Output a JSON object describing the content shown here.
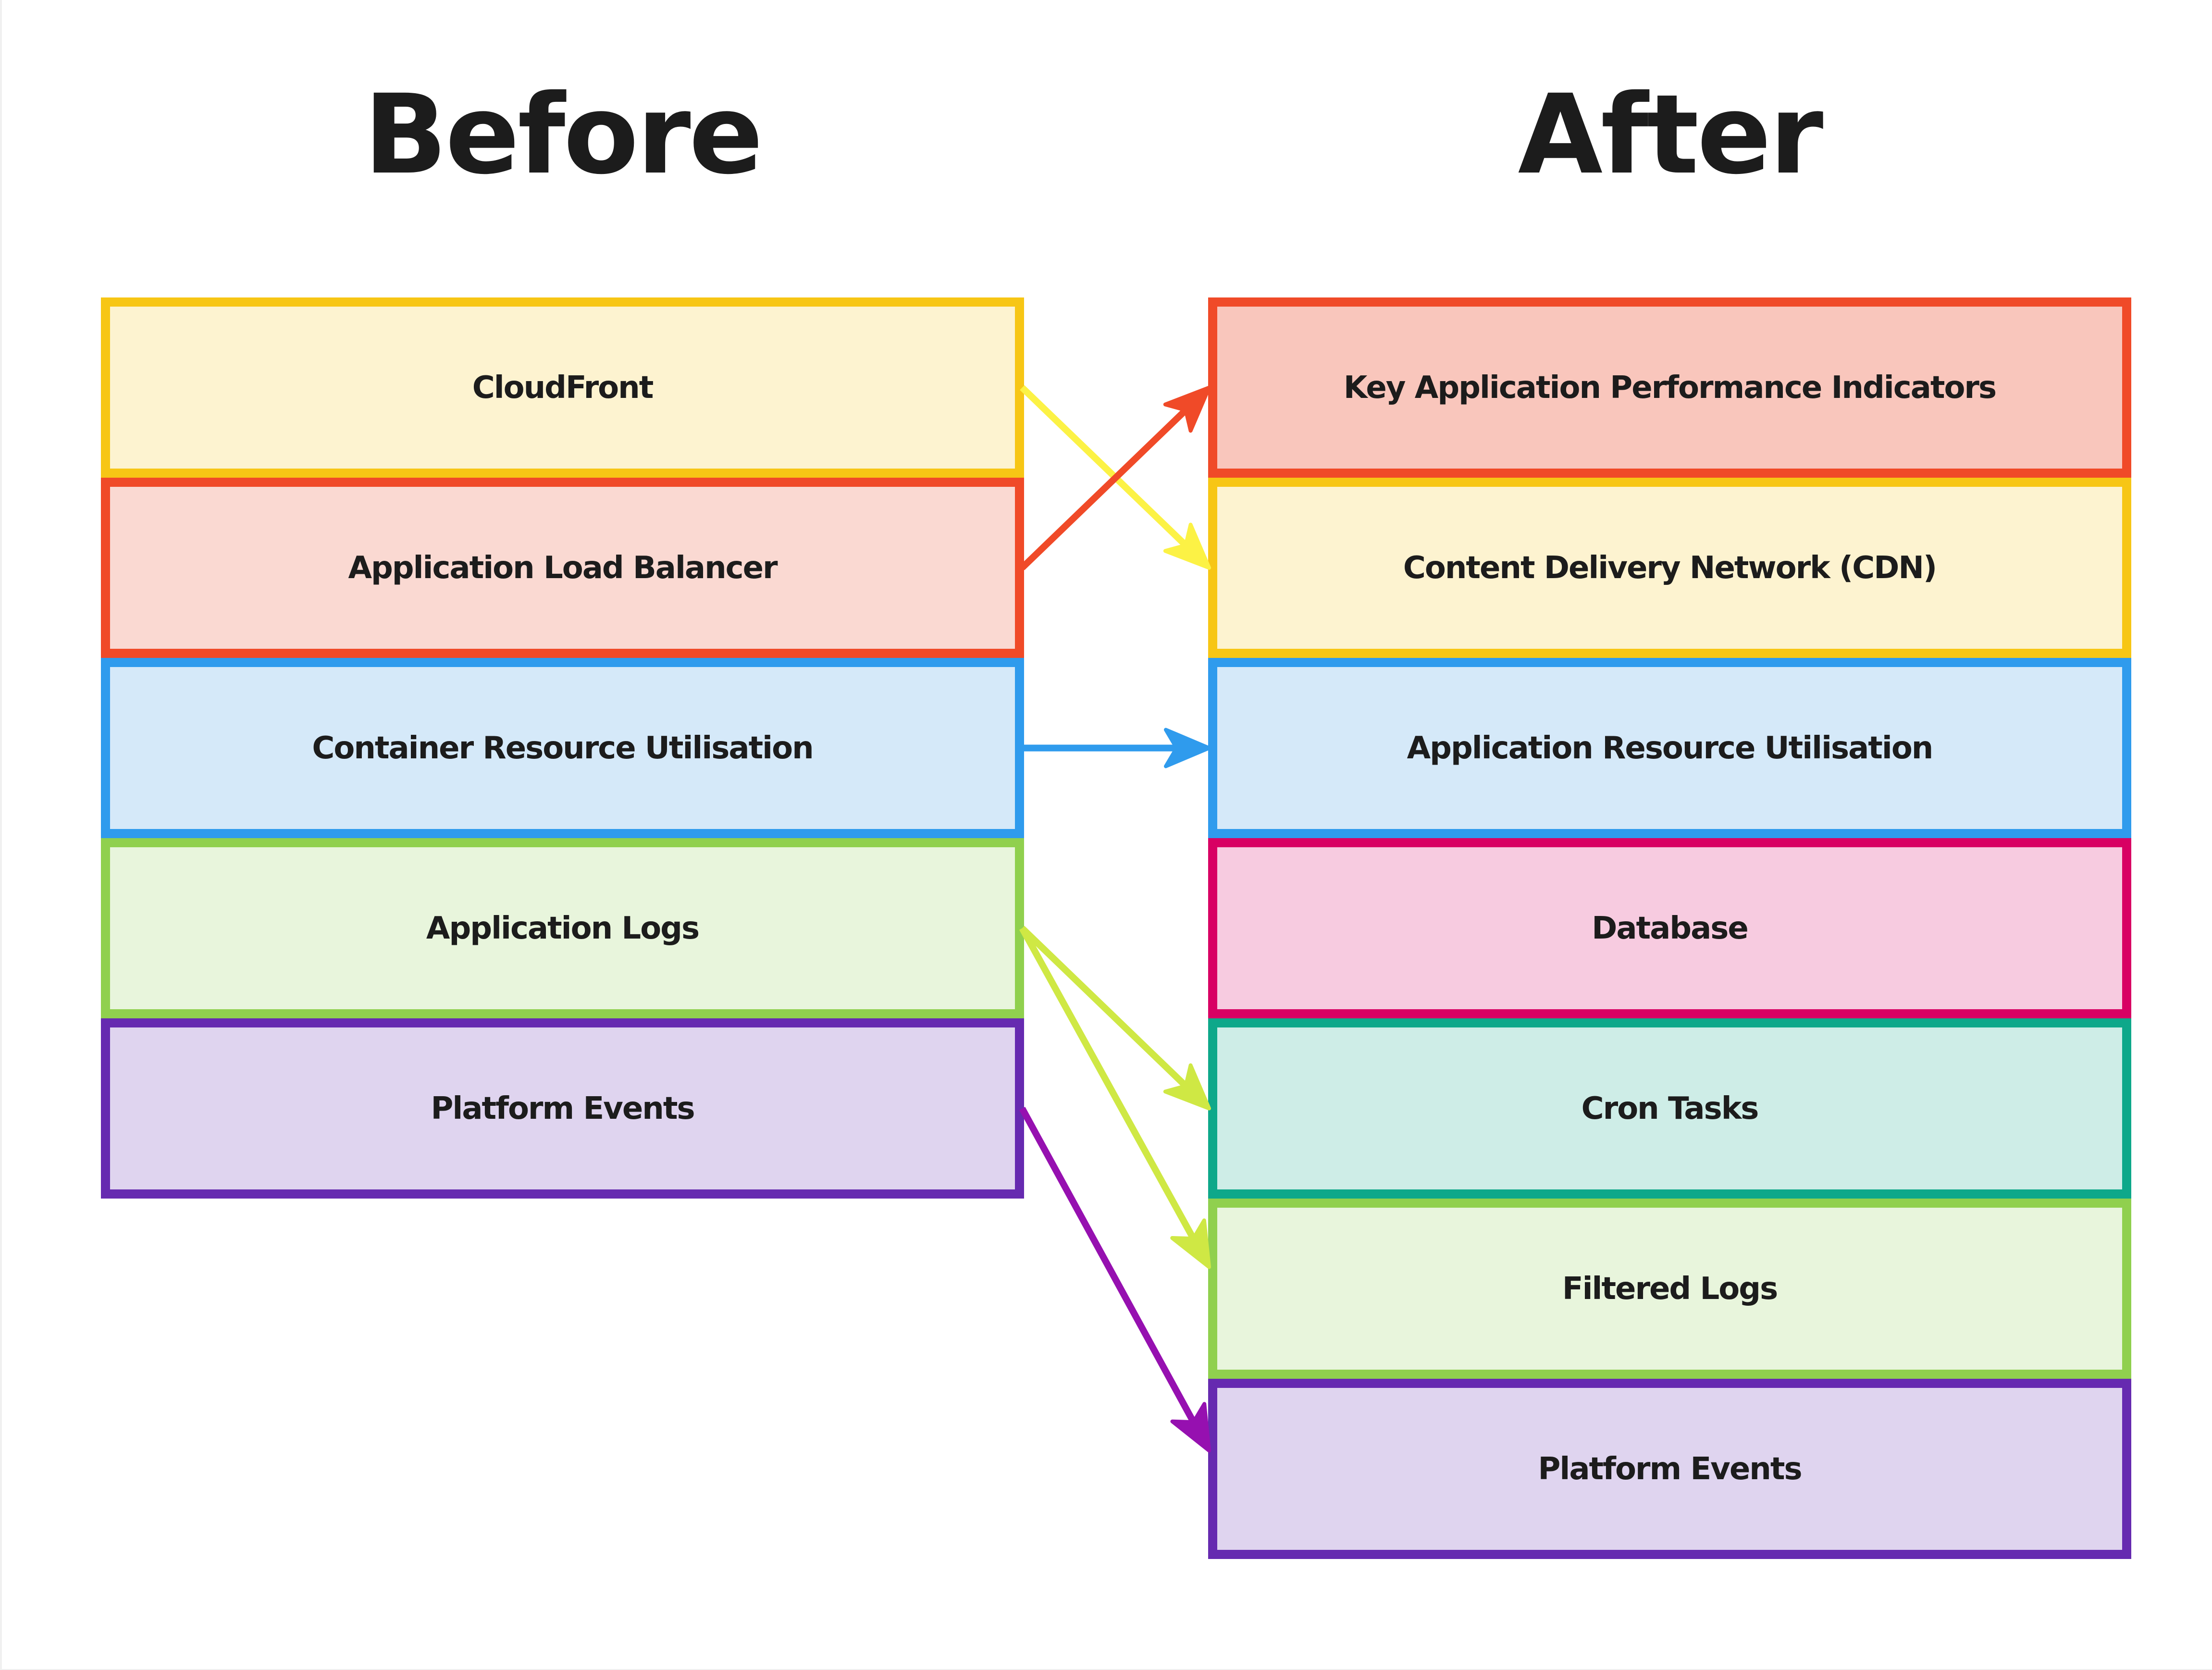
{
  "titles": {
    "before": "Before",
    "after": "After"
  },
  "before": {
    "items": [
      {
        "label": "CloudFront",
        "border": "#f7c615",
        "fill": "#fdf3d0"
      },
      {
        "label": "Application Load Balancer",
        "border": "#f04a28",
        "fill": "#fad9d2"
      },
      {
        "label": "Container Resource Utilisation",
        "border": "#2f9bed",
        "fill": "#d5e9f9"
      },
      {
        "label": "Application Logs",
        "border": "#90d04e",
        "fill": "#e8f5dc"
      },
      {
        "label": "Platform Events",
        "border": "#662ab0",
        "fill": "#dfd4ef"
      }
    ]
  },
  "after": {
    "items": [
      {
        "label": "Key Application Performance Indicators",
        "border": "#f04a28",
        "fill": "#f9c6bc"
      },
      {
        "label": "Content Delivery Network (CDN)",
        "border": "#f7c615",
        "fill": "#fdf3d0"
      },
      {
        "label": "Application Resource Utilisation",
        "border": "#2f9bed",
        "fill": "#d5e9f9"
      },
      {
        "label": "Database",
        "border": "#d80063",
        "fill": "#f7cbe0"
      },
      {
        "label": "Cron Tasks",
        "border": "#0ea88a",
        "fill": "#ceede7"
      },
      {
        "label": "Filtered Logs",
        "border": "#90d04e",
        "fill": "#e8f5dc"
      },
      {
        "label": "Platform Events",
        "border": "#662ab0",
        "fill": "#dfd4ef"
      }
    ]
  },
  "connections": [
    {
      "from": "CloudFront",
      "to": "Content Delivery Network (CDN)",
      "color": "#fcf245"
    },
    {
      "from": "Application Load Balancer",
      "to": "Key Application Performance Indicators",
      "color": "#f04a28"
    },
    {
      "from": "Container Resource Utilisation",
      "to": "Application Resource Utilisation",
      "color": "#2f9bed"
    },
    {
      "from": "Application Logs",
      "to": "Cron Tasks",
      "color": "#cfe844"
    },
    {
      "from": "Application Logs",
      "to": "Filtered Logs",
      "color": "#cfe844"
    },
    {
      "from": "Platform Events",
      "to": "Platform Events",
      "color": "#9610b0"
    }
  ]
}
